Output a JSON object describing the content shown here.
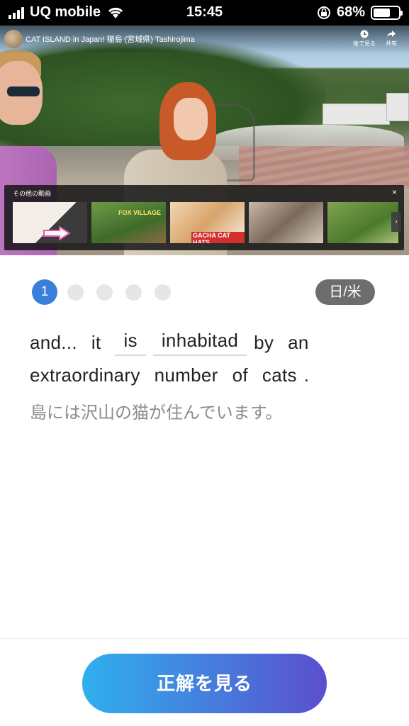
{
  "status_bar": {
    "carrier": "UQ mobile",
    "time": "15:45",
    "battery_percent_text": "68%",
    "battery_level": 0.68
  },
  "video": {
    "title": "CAT ISLAND in Japan!   猫島 (宮城県) Tashirojima",
    "watch_later_label": "後で見る",
    "share_label": "共有",
    "more_videos_label": "その他の動画",
    "close_glyph": "×",
    "next_glyph": "›",
    "thumbnails": [
      {
        "caption": ""
      },
      {
        "caption": "FOX VILLAGE"
      },
      {
        "caption": "GACHA CAT HATS"
      },
      {
        "caption": ""
      },
      {
        "caption": ""
      }
    ]
  },
  "pager": {
    "current": "1",
    "total": 5
  },
  "lang_toggle": "日/米",
  "exercise": {
    "line1": [
      "and...",
      "it",
      "is",
      "inhabitad",
      "by",
      "an"
    ],
    "line2": [
      "extraordinary",
      "number",
      "of",
      "cats",
      "."
    ],
    "translation": "島には沢山の猫が住んでいます。"
  },
  "cta_label": "正解を見る",
  "colors": {
    "accent_blue": "#3a7fdb",
    "cta_gradient_start": "#2fb0ee",
    "cta_gradient_end": "#5b4fce",
    "badge_gray": "#6d6d6d"
  }
}
